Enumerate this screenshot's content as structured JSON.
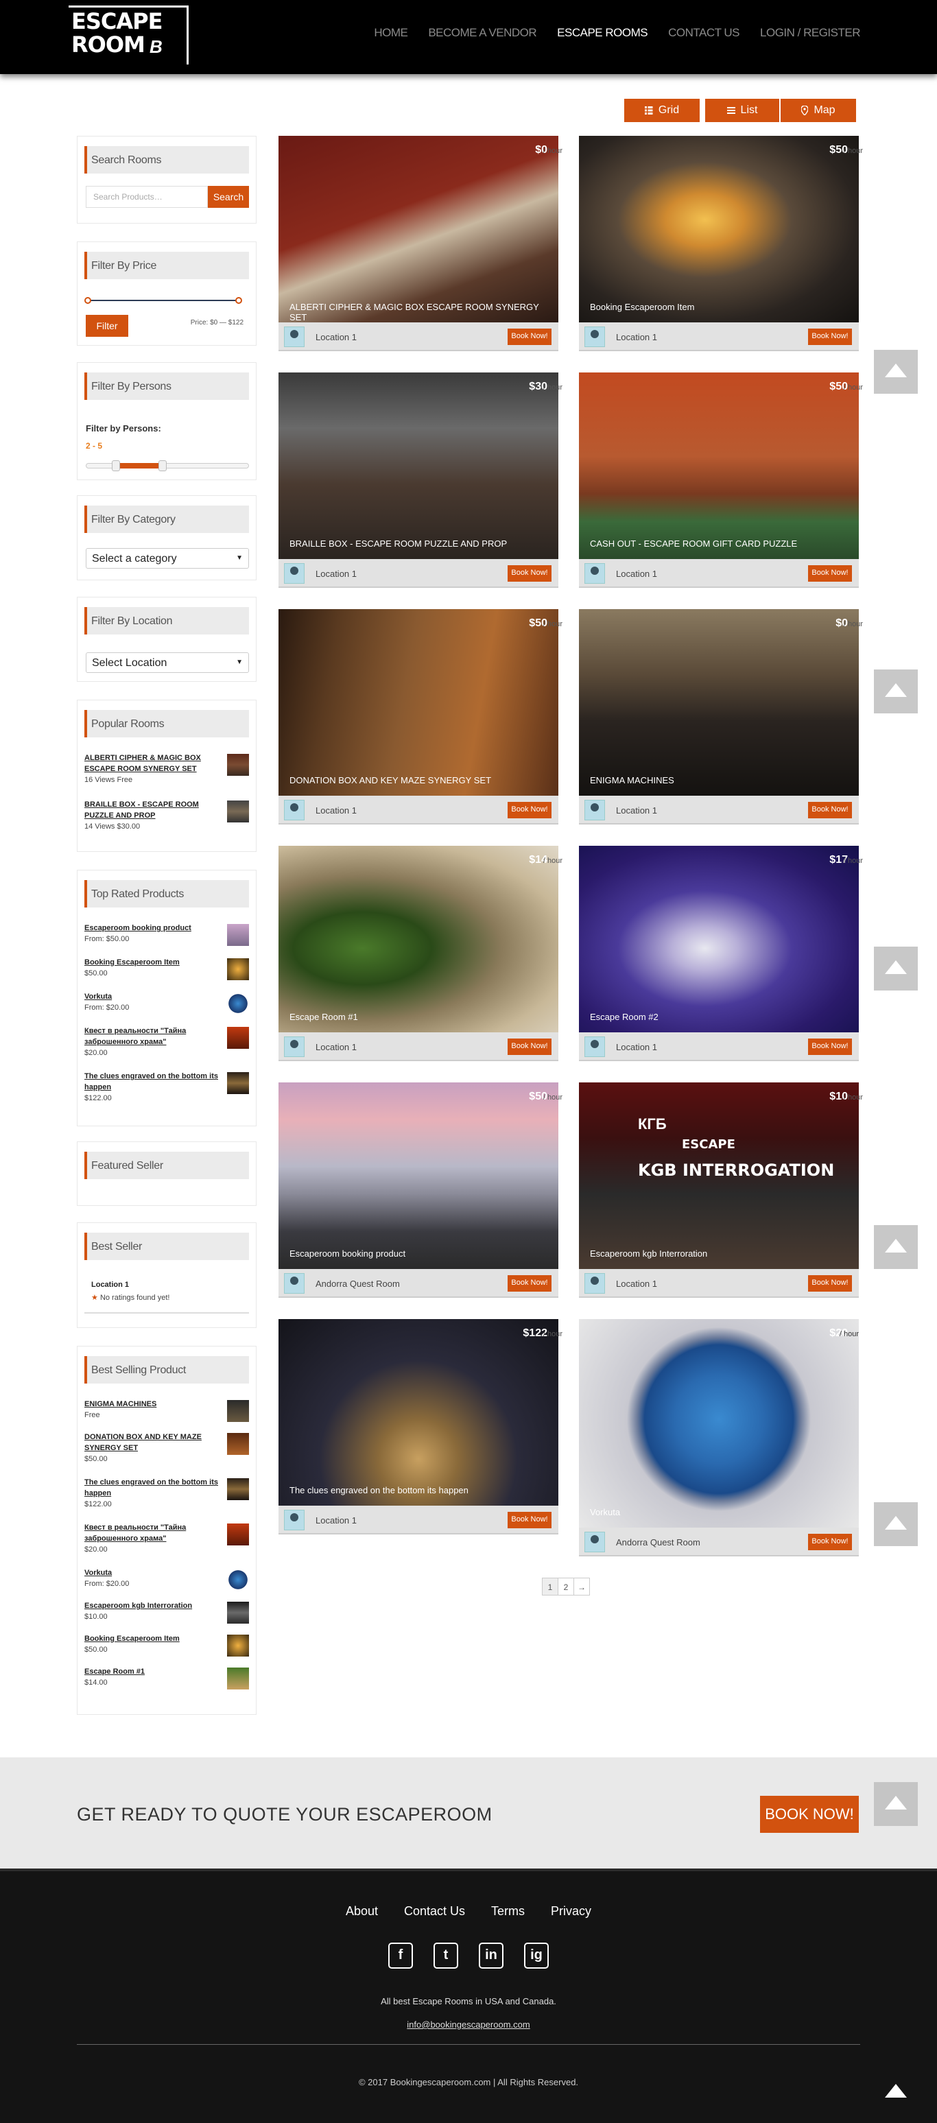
{
  "header": {
    "logo_line1": "ESCAPE",
    "logo_line2": "ROOM",
    "logo_mark": "B",
    "nav": [
      "HOME",
      "BECOME A VENDOR",
      "ESCAPE ROOMS",
      "CONTACT US",
      "LOGIN / REGISTER"
    ],
    "active_nav": "ESCAPE ROOMS"
  },
  "views": {
    "grid": "Grid",
    "list": "List",
    "map": "Map"
  },
  "sidebar": {
    "search": {
      "title": "Search Rooms",
      "placeholder": "Search Products…",
      "button": "Search"
    },
    "price": {
      "title": "Filter By Price",
      "button": "Filter",
      "range": "Price: $0 — $122"
    },
    "persons": {
      "title": "Filter By Persons",
      "label": "Filter by Persons:",
      "range": "2 - 5"
    },
    "category": {
      "title": "Filter By Category",
      "value": "Select a category"
    },
    "location": {
      "title": "Filter By Location",
      "value": "Select Location"
    },
    "popular": {
      "title": "Popular Rooms",
      "items": [
        {
          "name": "ALBERTI CIPHER & MAGIC BOX ESCAPE ROOM SYNERGY SET",
          "info": "16 Views Free"
        },
        {
          "name": "BRAILLE BOX - ESCAPE ROOM PUZZLE AND PROP",
          "info": "14 Views $30.00"
        }
      ]
    },
    "top_rated": {
      "title": "Top Rated Products",
      "items": [
        {
          "name": "Escaperoom booking product",
          "price": "From: $50.00"
        },
        {
          "name": "Booking Escaperoom Item",
          "price": "$50.00"
        },
        {
          "name": "Vorkuta",
          "price": "From: $20.00"
        },
        {
          "name": "Квест в реальности \"Тайна заброшенного храма\"",
          "price": "$20.00"
        },
        {
          "name": "The clues engraved on the bottom its happen",
          "price": "$122.00"
        }
      ]
    },
    "featured": {
      "title": "Featured Seller"
    },
    "best_seller": {
      "title": "Best Seller",
      "name": "Location 1",
      "rating": "No ratings found yet!"
    },
    "best_selling": {
      "title": "Best Selling Product",
      "items": [
        {
          "name": "ENIGMA MACHINES",
          "price": "Free"
        },
        {
          "name": "DONATION BOX AND KEY MAZE SYNERGY SET",
          "price": "$50.00"
        },
        {
          "name": "The clues engraved on the bottom its happen",
          "price": "$122.00"
        },
        {
          "name": "Квест в реальности \"Тайна заброшенного храма\"",
          "price": "$20.00"
        },
        {
          "name": "Vorkuta",
          "price": "From: $20.00"
        },
        {
          "name": "Escaperoom kgb Interroration",
          "price": "$10.00"
        },
        {
          "name": "Booking Escaperoom Item",
          "price": "$50.00"
        },
        {
          "name": "Escape Room #1",
          "price": "$14.00"
        }
      ]
    }
  },
  "rooms": [
    {
      "title": "ALBERTI CIPHER & MAGIC BOX ESCAPE ROOM SYNERGY SET",
      "price": "$0",
      "unit": "/ hour",
      "location": "Location 1",
      "book": "Book Now!"
    },
    {
      "title": "Booking Escaperoom Item",
      "price": "$50",
      "unit": "/ hour",
      "location": "Location 1",
      "book": "Book Now!"
    },
    {
      "title": "BRAILLE BOX - ESCAPE ROOM PUZZLE AND PROP",
      "price": "$30",
      "unit": "/ hour",
      "location": "Location 1",
      "book": "Book Now!"
    },
    {
      "title": "CASH OUT - ESCAPE ROOM GIFT CARD PUZZLE",
      "price": "$50",
      "unit": "/ hour",
      "location": "Location 1",
      "book": "Book Now!"
    },
    {
      "title": "DONATION BOX AND KEY MAZE SYNERGY SET",
      "price": "$50",
      "unit": "/ hour",
      "location": "Location 1",
      "book": "Book Now!"
    },
    {
      "title": "ENIGMA MACHINES",
      "price": "$0",
      "unit": "/ hour",
      "location": "Location 1",
      "book": "Book Now!"
    },
    {
      "title": "Escape Room #1",
      "price": "$14",
      "unit": "/ hour",
      "location": "Location 1",
      "book": "Book Now!"
    },
    {
      "title": "Escape Room #2",
      "price": "$17",
      "unit": "/ hour",
      "location": "Location 1",
      "book": "Book Now!"
    },
    {
      "title": "Escaperoom booking product",
      "price": "$50",
      "unit": "/ hour",
      "location": "Andorra Quest Room",
      "book": "Book Now!"
    },
    {
      "title": "Escaperoom kgb Interroration",
      "price": "$10",
      "unit": "/ hour",
      "location": "Location 1",
      "book": "Book Now!",
      "overlay1": "ESCAPE",
      "overlay2": "KGB INTERROGATION",
      "overlay3": "КГБ"
    },
    {
      "title": "The clues engraved on the bottom its happen",
      "price": "$122",
      "unit": "/ hour",
      "location": "Location 1",
      "book": "Book Now!"
    },
    {
      "title": "Vorkuta",
      "price": "$20",
      "unit": "/ hour",
      "location": "Andorra Quest Room",
      "book": "Book Now!"
    }
  ],
  "pagination": {
    "p1": "1",
    "p2": "2",
    "next": "→"
  },
  "cta": {
    "text": "GET READY TO QUOTE YOUR ESCAPEROOM",
    "button": "BOOK NOW!"
  },
  "footer": {
    "links": [
      "About",
      "Contact Us",
      "Terms",
      "Privacy"
    ],
    "social": [
      "f",
      "t",
      "in",
      "ig"
    ],
    "tagline": "All best Escape Rooms in USA and Canada.",
    "email": "info@bookingescaperoom.com",
    "copyright": "© 2017 Bookingescaperoom.com | All Rights Reserved."
  }
}
